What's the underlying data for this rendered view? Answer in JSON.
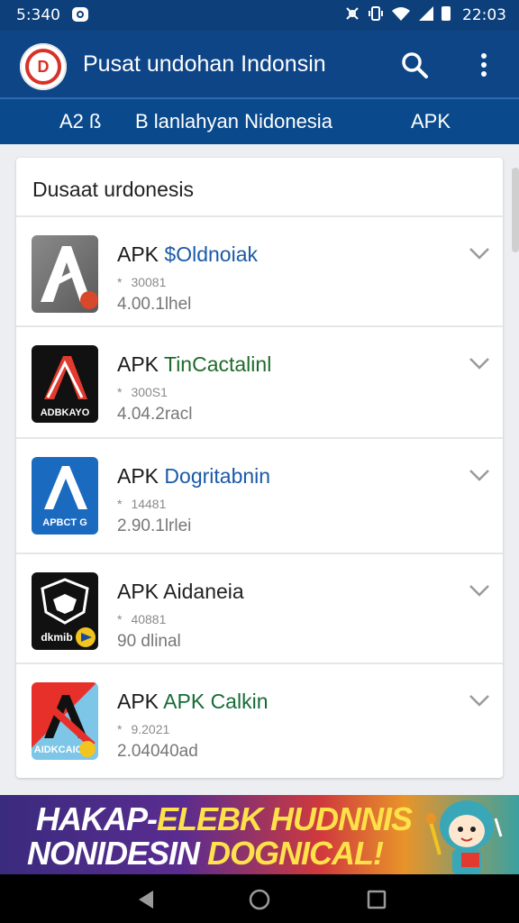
{
  "status_bar": {
    "time_left": "5:340",
    "time_right": "22:03"
  },
  "app_bar": {
    "title": "Pusat undohan Indonsin",
    "logo_letter": "D"
  },
  "tabs": [
    {
      "label": "A2 ß"
    },
    {
      "label": "B lanlahyan Nidonesia"
    },
    {
      "label": "APK"
    }
  ],
  "card": {
    "title": "Dusaat urdonesis"
  },
  "items": [
    {
      "prefix": "APK ",
      "brand": "$Oldnoiak",
      "rating": "30081",
      "size": "4.00.1lhel",
      "icon_label": ""
    },
    {
      "prefix": "APK ",
      "brand": "TinCactalinl",
      "rating": "300S1",
      "size": "4.04.2racl",
      "icon_label": "ADBKAYO"
    },
    {
      "prefix": "APK ",
      "brand": "Dogritabnin",
      "rating": "14481",
      "size": "2.90.1lrlei",
      "icon_label": "APBCT G"
    },
    {
      "prefix": "APK ",
      "brand": "Aidaneia",
      "rating": "40881",
      "size": "90 dlinal",
      "icon_label": "dkmib"
    },
    {
      "prefix": "APK ",
      "brand": "APK Calkin",
      "rating": "9.2021",
      "size": "2.04040ad",
      "icon_label": "AIDKCAIO"
    }
  ],
  "banner": {
    "line1_a": "HAKAP-",
    "line1_b": "ELEBK HUDNNIS",
    "line2_a": "NONIDESIN ",
    "line2_b": "DOGNICAL!"
  },
  "colors": {
    "primary": "#0d4587",
    "accent": "#d63228"
  }
}
